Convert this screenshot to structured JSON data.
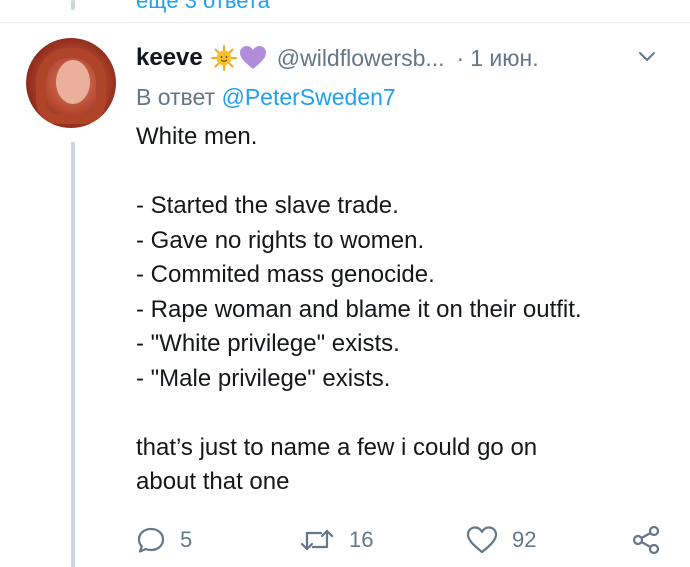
{
  "top_link": "ещё 3 ответа",
  "tweet": {
    "display_name": "keeve",
    "handle": "@wildflowersb...",
    "separator": "·",
    "date": "1 июн.",
    "reply_prefix": "В ответ",
    "reply_mention": "@PeterSweden7",
    "lines": [
      "White men.",
      "",
      "- Started the slave trade.",
      "- Gave no rights to women.",
      "- Commited mass genocide.",
      "- Rape woman and blame it on their outfit.",
      "- \"White privilege\" exists.",
      "- \"Male privilege\" exists.",
      "",
      "that’s just to name a few i could go on",
      "about that one"
    ]
  },
  "actions": {
    "replies": "5",
    "retweets": "16",
    "likes": "92"
  },
  "icons": [
    "sun-emoji-icon",
    "purple-heart-emoji-icon",
    "chevron-down-icon",
    "reply-icon",
    "retweet-icon",
    "like-icon",
    "share-icon"
  ],
  "colors": {
    "link": "#1da1f2",
    "secondary": "#657786",
    "text": "#14171a",
    "thread": "#ccd6dd",
    "heart": "#b18cdb",
    "sun": "#f7c22b"
  }
}
